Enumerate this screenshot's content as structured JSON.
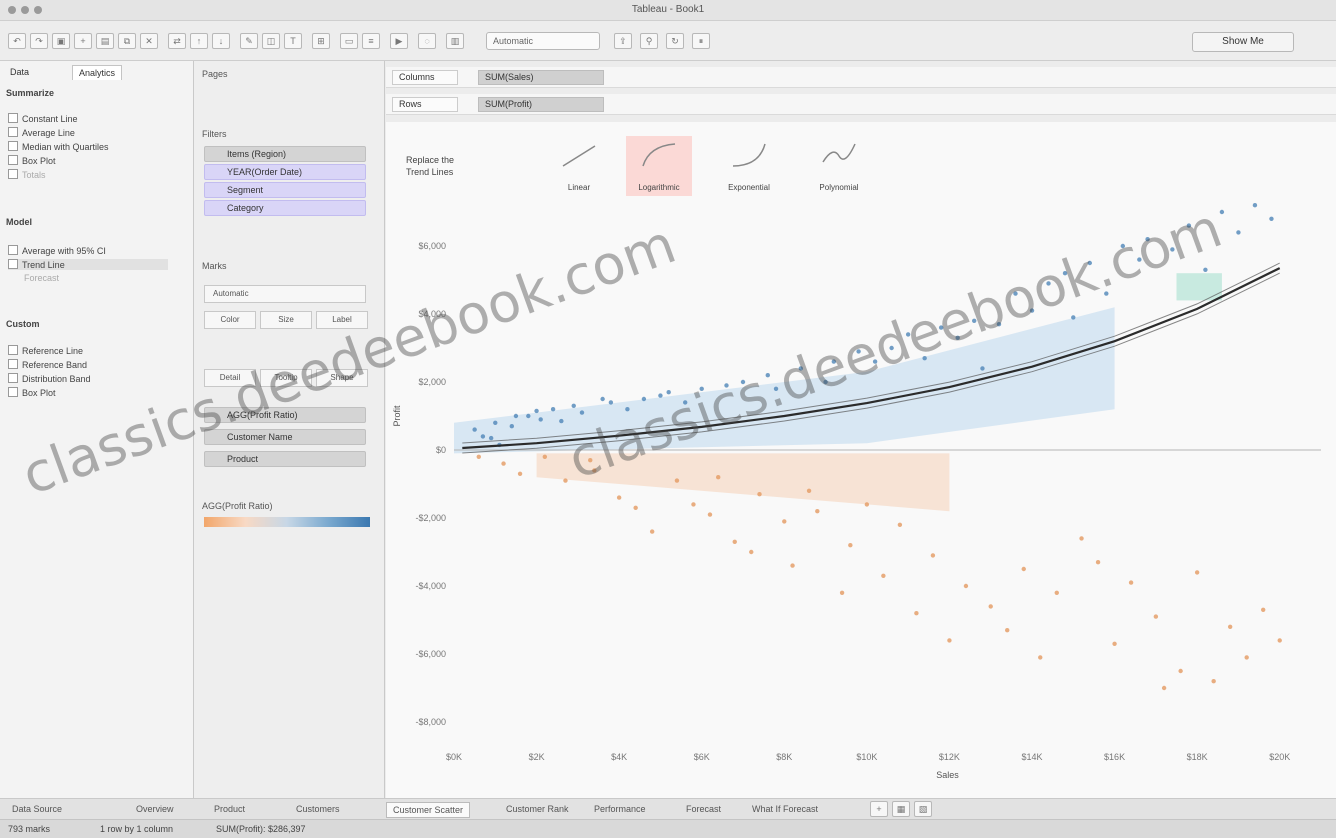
{
  "window": {
    "title": "Tableau - Book1"
  },
  "toolbar": {
    "marks_select": "Automatic",
    "show_me": "Show Me"
  },
  "left_panel": {
    "tabs": [
      "Data",
      "Analytics"
    ],
    "summarize": {
      "title": "Summarize",
      "items": [
        "Constant Line",
        "Average Line",
        "Median with Quartiles",
        "Box Plot",
        "Totals"
      ]
    },
    "model": {
      "title": "Model",
      "items": [
        "Average with 95% CI",
        "Trend Line",
        "Forecast"
      ]
    },
    "custom": {
      "title": "Custom",
      "items": [
        "Reference Line",
        "Reference Band",
        "Distribution Band",
        "Box Plot"
      ]
    }
  },
  "middle_panel": {
    "pages": "Pages",
    "filters": "Filters",
    "filter_pills": [
      "Items (Region)",
      "YEAR(Order Date)",
      "Segment",
      "Category"
    ],
    "marks": "Marks",
    "mark_type": "Automatic",
    "mark_buttons": [
      "Color",
      "Size",
      "Label",
      "Detail",
      "Tooltip",
      "Shape"
    ],
    "detail_pills": [
      "Customer Name",
      "Product"
    ],
    "color_pill": "AGG(Profit Ratio)"
  },
  "shelves": {
    "columns": {
      "label": "Columns",
      "pill": "SUM(Sales)"
    },
    "rows": {
      "label": "Rows",
      "pill": "SUM(Profit)"
    }
  },
  "trend_popup": {
    "label_line1": "Replace the",
    "label_line2": "Trend Lines",
    "options": [
      "Linear",
      "Logarithmic",
      "Exponential",
      "Polynomial"
    ]
  },
  "bottom_tabs": [
    "Data Source",
    "Overview",
    "Product",
    "Customers",
    "Customer Scatter",
    "Customer Rank",
    "Performance",
    "Forecast",
    "What If Forecast"
  ],
  "status": {
    "marks": "793 marks",
    "rows_cols": "1 row by 1 column",
    "sum": "SUM(Profit): $286,397"
  },
  "watermark": "classics.deedeebook.com",
  "chart_data": {
    "type": "scatter",
    "x_tick_labels": [
      "$0K",
      "$2K",
      "$4K",
      "$6K",
      "$8K",
      "$10K",
      "$12K",
      "$14K",
      "$16K",
      "$18K",
      "$20K"
    ],
    "y_tick_labels": [
      "$6,000",
      "$4,000",
      "$2,000",
      "$0",
      "-$2,000",
      "-$4,000",
      "-$6,000",
      "-$8,000"
    ],
    "xlabel": "Sales",
    "ylabel": "Profit",
    "series": [
      {
        "points": [
          [
            0.5,
            600
          ],
          [
            0.6,
            -200
          ],
          [
            0.7,
            400
          ],
          [
            0.9,
            350
          ],
          [
            1,
            800
          ],
          [
            1.1,
            150
          ],
          [
            1.2,
            -400
          ],
          [
            1.4,
            700
          ],
          [
            1.5,
            1000
          ],
          [
            1.6,
            -700
          ],
          [
            1.8,
            1000
          ],
          [
            2,
            1150
          ],
          [
            2.1,
            900
          ],
          [
            2.2,
            -200
          ],
          [
            2.4,
            1200
          ],
          [
            2.6,
            850
          ],
          [
            2.7,
            -900
          ],
          [
            2.9,
            1300
          ],
          [
            3.1,
            1100
          ],
          [
            3.3,
            -300
          ],
          [
            3.4,
            -600
          ],
          [
            3.6,
            1500
          ],
          [
            3.8,
            1400
          ],
          [
            4,
            -1400
          ],
          [
            4.2,
            1200
          ],
          [
            4.4,
            -1700
          ],
          [
            4.6,
            1500
          ],
          [
            4.8,
            -2400
          ],
          [
            5,
            1600
          ],
          [
            5.2,
            1700
          ],
          [
            5.4,
            -900
          ],
          [
            5.6,
            1400
          ],
          [
            5.8,
            -1600
          ],
          [
            6,
            1800
          ],
          [
            6.2,
            -1900
          ],
          [
            6.4,
            -800
          ],
          [
            6.6,
            1900
          ],
          [
            6.8,
            -2700
          ],
          [
            7,
            2000
          ],
          [
            7.2,
            -3000
          ],
          [
            7.4,
            -1300
          ],
          [
            7.6,
            2200
          ],
          [
            7.8,
            1800
          ],
          [
            8,
            -2100
          ],
          [
            8.2,
            -3400
          ],
          [
            8.4,
            2400
          ],
          [
            8.6,
            -1200
          ],
          [
            8.8,
            -1800
          ],
          [
            9,
            2000
          ],
          [
            9.2,
            2600
          ],
          [
            9.4,
            -4200
          ],
          [
            9.6,
            -2800
          ],
          [
            9.8,
            2900
          ],
          [
            10,
            -1600
          ],
          [
            10.2,
            2600
          ],
          [
            10.4,
            -3700
          ],
          [
            10.6,
            3000
          ],
          [
            10.8,
            -2200
          ],
          [
            11,
            3400
          ],
          [
            11.2,
            -4800
          ],
          [
            11.4,
            2700
          ],
          [
            11.6,
            -3100
          ],
          [
            11.8,
            3600
          ],
          [
            12,
            -5600
          ],
          [
            12.2,
            3300
          ],
          [
            12.4,
            -4000
          ],
          [
            12.6,
            3800
          ],
          [
            12.8,
            2400
          ],
          [
            13,
            -4600
          ],
          [
            13.2,
            3700
          ],
          [
            13.4,
            -5300
          ],
          [
            13.6,
            4600
          ],
          [
            13.8,
            -3500
          ],
          [
            14,
            4100
          ],
          [
            14.2,
            -6100
          ],
          [
            14.4,
            4900
          ],
          [
            14.6,
            -4200
          ],
          [
            14.8,
            5200
          ],
          [
            15,
            3900
          ],
          [
            15.2,
            -2600
          ],
          [
            15.4,
            5500
          ],
          [
            15.6,
            -3300
          ],
          [
            15.8,
            4600
          ],
          [
            16,
            -5700
          ],
          [
            16.2,
            6000
          ],
          [
            16.4,
            -3900
          ],
          [
            16.6,
            5600
          ],
          [
            16.8,
            6200
          ],
          [
            17,
            -4900
          ],
          [
            17.2,
            -7000
          ],
          [
            17.4,
            5900
          ],
          [
            17.6,
            -6500
          ],
          [
            17.8,
            6600
          ],
          [
            18,
            -3600
          ],
          [
            18.2,
            5300
          ],
          [
            18.4,
            -6800
          ],
          [
            18.6,
            7000
          ],
          [
            18.8,
            -5200
          ],
          [
            19,
            6400
          ],
          [
            19.2,
            -6100
          ],
          [
            19.4,
            7200
          ],
          [
            19.6,
            -4700
          ],
          [
            19.8,
            6800
          ],
          [
            20,
            -5600
          ]
        ]
      }
    ],
    "trend": {
      "x": [
        0.2,
        2,
        4,
        6,
        8,
        10,
        12,
        14,
        16,
        18,
        20
      ],
      "y": [
        60,
        200,
        420,
        680,
        1000,
        1380,
        1850,
        2450,
        3200,
        4150,
        5350
      ]
    },
    "xlim": [
      0,
      21
    ],
    "ylim": [
      -8000,
      7000
    ],
    "grid": false
  }
}
